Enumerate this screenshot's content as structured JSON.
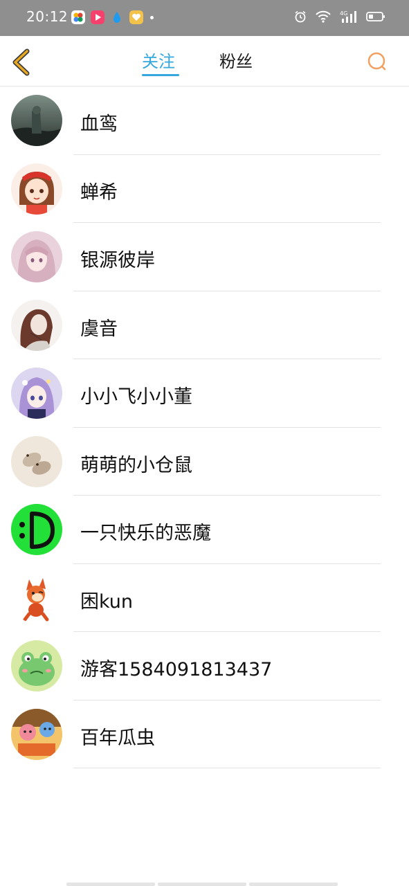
{
  "status_bar": {
    "time": "20:12",
    "app_icons": [
      "photos-app-icon",
      "video-app-icon",
      "drop-app-icon",
      "heart-app-icon"
    ],
    "network": "4G",
    "background_color": "#8f8f8f"
  },
  "navbar": {
    "back_icon": "chevron-left-icon",
    "tabs": [
      {
        "label": "关注",
        "active": true
      },
      {
        "label": "粉丝",
        "active": false
      }
    ],
    "search_icon": "search-icon",
    "accent_color": "#34a7dc",
    "back_color": "#e0a020",
    "search_color": "#f0a060"
  },
  "follow_list": [
    {
      "name": "血鸾",
      "avatar": "dark-landscape-avatar"
    },
    {
      "name": "蝉希",
      "avatar": "anime-girl-red-avatar"
    },
    {
      "name": "银源彼岸",
      "avatar": "anime-girl-pink-avatar"
    },
    {
      "name": "虞音",
      "avatar": "sketch-girl-avatar"
    },
    {
      "name": "小小飞小小董",
      "avatar": "anime-girl-purple-avatar"
    },
    {
      "name": "萌萌的小仓鼠",
      "avatar": "hamster-avatar"
    },
    {
      "name": "一只快乐的恶魔",
      "avatar": "green-smiley-avatar"
    },
    {
      "name": "困kun",
      "avatar": "cartoon-fox-avatar"
    },
    {
      "name": "游客1584091813437",
      "avatar": "green-frog-avatar"
    },
    {
      "name": "百年瓜虫",
      "avatar": "colorful-cartoon-avatar"
    }
  ]
}
